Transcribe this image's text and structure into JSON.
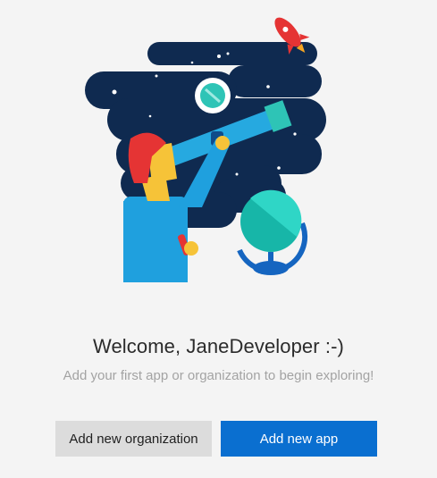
{
  "welcome": {
    "title": "Welcome, JaneDeveloper :-)",
    "subtitle": "Add your first app or organization to begin exploring!"
  },
  "actions": {
    "add_organization_label": "Add new organization",
    "add_app_label": "Add new app"
  },
  "colors": {
    "background": "#f4f4f4",
    "primary_button": "#0a6fd0",
    "secondary_button": "#dcdcdc",
    "night_sky": "#0f2a50"
  },
  "illustration": {
    "icon": "astronomer-telescope-illustration"
  }
}
